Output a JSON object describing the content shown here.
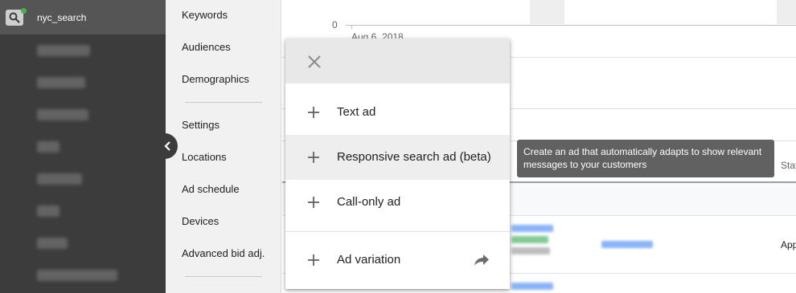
{
  "sidebar": {
    "campaign_name": "nyc_search",
    "search_icon": "search-icon",
    "status_dot_color": "#4caf50",
    "blurred_items_count_label": "campaign list (blurred)"
  },
  "page_menu": {
    "items": [
      {
        "label": "Keywords"
      },
      {
        "label": "Audiences"
      },
      {
        "label": "Demographics"
      },
      {
        "label": "Settings"
      },
      {
        "label": "Locations"
      },
      {
        "label": "Ad schedule"
      },
      {
        "label": "Devices"
      },
      {
        "label": "Advanced bid adj."
      }
    ],
    "collapse_icon": "chevron-left-icon"
  },
  "chart": {
    "zero_tick": "0",
    "date_label": "Aug 6, 2018"
  },
  "table": {
    "status_header": "Stat",
    "status_cell": "App"
  },
  "menu": {
    "close_icon": "close-icon",
    "items": [
      {
        "label": "Text ad",
        "icon": "plus-icon"
      },
      {
        "label": "Responsive search ad (beta)",
        "icon": "plus-icon"
      },
      {
        "label": "Call-only ad",
        "icon": "plus-icon"
      },
      {
        "label": "Ad variation",
        "icon": "plus-icon",
        "trailing_icon": "share-arrow-icon"
      }
    ]
  },
  "tooltip": {
    "text": "Create an ad that automatically adapts to show relevant messages to your customers"
  },
  "colors": {
    "sidebar_bg": "#3c3c3c",
    "sidebar_header_bg": "#555555",
    "page_menu_bg": "#f1f1f1",
    "menu_header_bg": "#e8e8e8",
    "tooltip_bg": "#616161",
    "link_blue": "#1a73e8",
    "link_green": "#188038"
  }
}
